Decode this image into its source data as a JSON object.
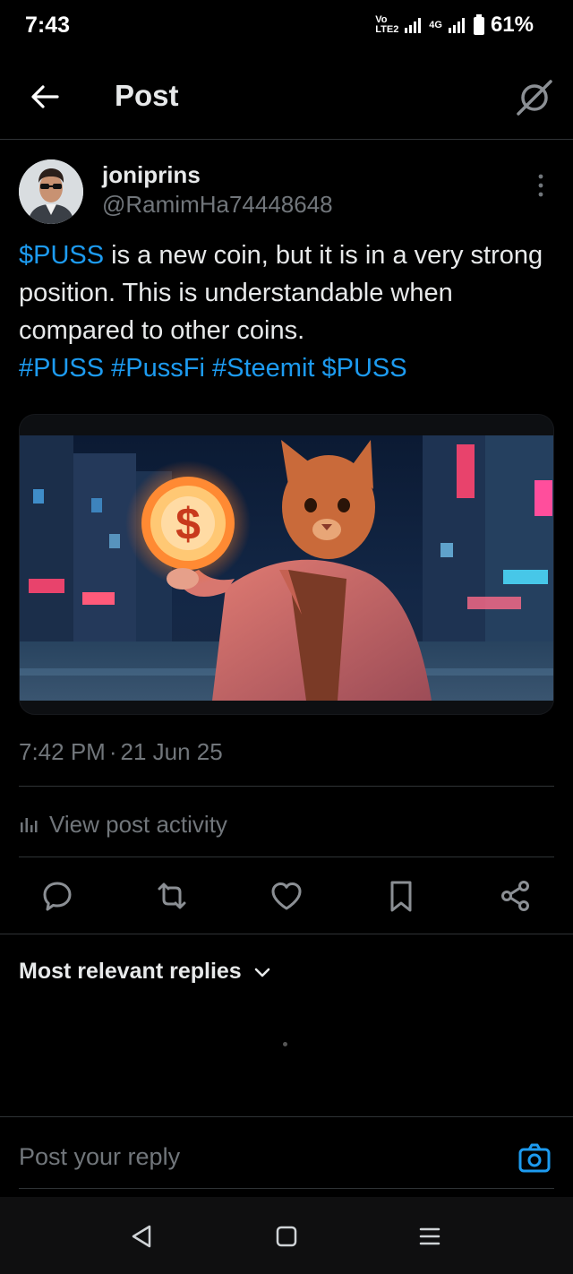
{
  "status_bar": {
    "time": "7:43",
    "network_label": "Vo LTE2",
    "network_type": "4G",
    "battery": "61%"
  },
  "top_bar": {
    "title": "Post",
    "back_icon": "arrow-left-icon",
    "grok_icon": "grok-icon"
  },
  "post": {
    "author": {
      "display_name": "joniprins",
      "handle": "@RamimHa74448648"
    },
    "text": {
      "cashtag_1": "$PUSS",
      "body_1": " is a new coin, but it is in a very strong position. This is understandable when compared to other coins.",
      "hashtag_1": "#PUSS",
      "hashtag_2": "#PussFi",
      "hashtag_3": "#Steemit",
      "cashtag_2": "$PUSS"
    },
    "timestamp": {
      "time": "7:42 PM",
      "separator": "·",
      "date": "21 Jun 25"
    },
    "activity_label": "View post activity"
  },
  "actions": [
    "reply-icon",
    "repost-icon",
    "like-icon",
    "bookmark-icon",
    "share-icon"
  ],
  "replies": {
    "header": "Most relevant replies"
  },
  "composer": {
    "placeholder": "Post your reply"
  },
  "colors": {
    "background": "#000000",
    "text_primary": "#e7e9ea",
    "text_secondary": "#71767b",
    "link": "#1d9bf0",
    "divider": "#2f3336"
  }
}
